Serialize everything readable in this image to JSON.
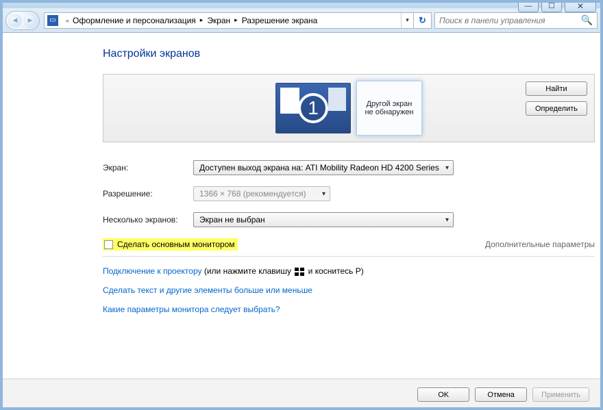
{
  "titlebar": {
    "min": "—",
    "max": "☐",
    "close": "✕"
  },
  "breadcrumb": {
    "root_chev": "«",
    "items": [
      "Оформление и персонализация",
      "Экран",
      "Разрешение экрана"
    ]
  },
  "search": {
    "placeholder": "Поиск в панели управления"
  },
  "heading": "Настройки экранов",
  "preview": {
    "monitor_num": "1",
    "ghost_text": "Другой экран не обнаружен",
    "find_button": "Найти",
    "detect_button": "Определить"
  },
  "form": {
    "screen_label": "Экран:",
    "screen_value": "Доступен выход экрана на: ATI Mobility Radeon HD 4200 Series",
    "resolution_label": "Разрешение:",
    "resolution_value": "1366 × 768 (рекомендуется)",
    "multi_label": "Несколько экранов:",
    "multi_value": "Экран не выбран"
  },
  "checkbox_label": "Сделать основным монитором",
  "advanced_link": "Дополнительные параметры",
  "links": {
    "projector_link": "Подключение к проектору",
    "projector_tail_a": " (или нажмите клавишу ",
    "projector_tail_b": " и коснитесь P)",
    "text_size": "Сделать текст и другие элементы больше или меньше",
    "which_monitor": "Какие параметры монитора следует выбрать?"
  },
  "footer": {
    "ok": "OK",
    "cancel": "Отмена",
    "apply": "Применить"
  }
}
